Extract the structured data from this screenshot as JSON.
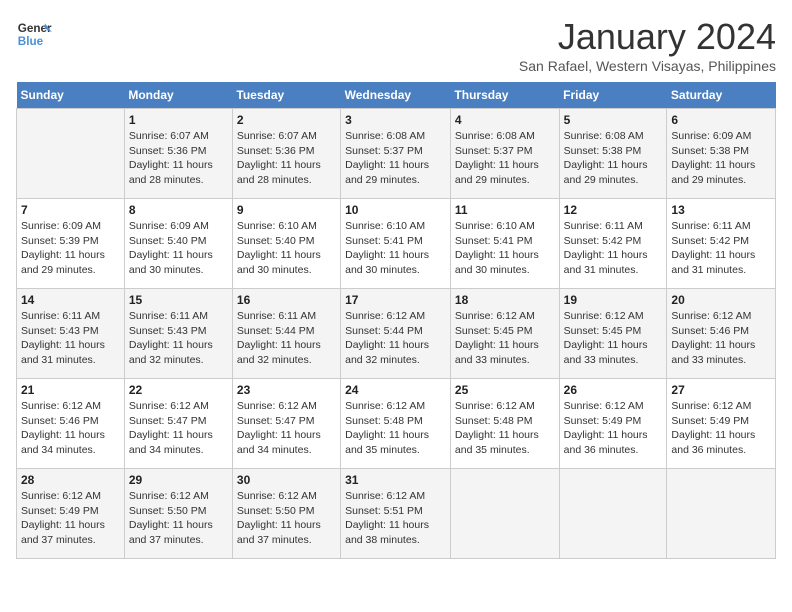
{
  "header": {
    "logo_line1": "General",
    "logo_line2": "Blue",
    "title": "January 2024",
    "subtitle": "San Rafael, Western Visayas, Philippines"
  },
  "columns": [
    "Sunday",
    "Monday",
    "Tuesday",
    "Wednesday",
    "Thursday",
    "Friday",
    "Saturday"
  ],
  "weeks": [
    [
      {
        "day": "",
        "info": ""
      },
      {
        "day": "1",
        "info": "Sunrise: 6:07 AM\nSunset: 5:36 PM\nDaylight: 11 hours\nand 28 minutes."
      },
      {
        "day": "2",
        "info": "Sunrise: 6:07 AM\nSunset: 5:36 PM\nDaylight: 11 hours\nand 28 minutes."
      },
      {
        "day": "3",
        "info": "Sunrise: 6:08 AM\nSunset: 5:37 PM\nDaylight: 11 hours\nand 29 minutes."
      },
      {
        "day": "4",
        "info": "Sunrise: 6:08 AM\nSunset: 5:37 PM\nDaylight: 11 hours\nand 29 minutes."
      },
      {
        "day": "5",
        "info": "Sunrise: 6:08 AM\nSunset: 5:38 PM\nDaylight: 11 hours\nand 29 minutes."
      },
      {
        "day": "6",
        "info": "Sunrise: 6:09 AM\nSunset: 5:38 PM\nDaylight: 11 hours\nand 29 minutes."
      }
    ],
    [
      {
        "day": "7",
        "info": "Sunrise: 6:09 AM\nSunset: 5:39 PM\nDaylight: 11 hours\nand 29 minutes."
      },
      {
        "day": "8",
        "info": "Sunrise: 6:09 AM\nSunset: 5:40 PM\nDaylight: 11 hours\nand 30 minutes."
      },
      {
        "day": "9",
        "info": "Sunrise: 6:10 AM\nSunset: 5:40 PM\nDaylight: 11 hours\nand 30 minutes."
      },
      {
        "day": "10",
        "info": "Sunrise: 6:10 AM\nSunset: 5:41 PM\nDaylight: 11 hours\nand 30 minutes."
      },
      {
        "day": "11",
        "info": "Sunrise: 6:10 AM\nSunset: 5:41 PM\nDaylight: 11 hours\nand 30 minutes."
      },
      {
        "day": "12",
        "info": "Sunrise: 6:11 AM\nSunset: 5:42 PM\nDaylight: 11 hours\nand 31 minutes."
      },
      {
        "day": "13",
        "info": "Sunrise: 6:11 AM\nSunset: 5:42 PM\nDaylight: 11 hours\nand 31 minutes."
      }
    ],
    [
      {
        "day": "14",
        "info": "Sunrise: 6:11 AM\nSunset: 5:43 PM\nDaylight: 11 hours\nand 31 minutes."
      },
      {
        "day": "15",
        "info": "Sunrise: 6:11 AM\nSunset: 5:43 PM\nDaylight: 11 hours\nand 32 minutes."
      },
      {
        "day": "16",
        "info": "Sunrise: 6:11 AM\nSunset: 5:44 PM\nDaylight: 11 hours\nand 32 minutes."
      },
      {
        "day": "17",
        "info": "Sunrise: 6:12 AM\nSunset: 5:44 PM\nDaylight: 11 hours\nand 32 minutes."
      },
      {
        "day": "18",
        "info": "Sunrise: 6:12 AM\nSunset: 5:45 PM\nDaylight: 11 hours\nand 33 minutes."
      },
      {
        "day": "19",
        "info": "Sunrise: 6:12 AM\nSunset: 5:45 PM\nDaylight: 11 hours\nand 33 minutes."
      },
      {
        "day": "20",
        "info": "Sunrise: 6:12 AM\nSunset: 5:46 PM\nDaylight: 11 hours\nand 33 minutes."
      }
    ],
    [
      {
        "day": "21",
        "info": "Sunrise: 6:12 AM\nSunset: 5:46 PM\nDaylight: 11 hours\nand 34 minutes."
      },
      {
        "day": "22",
        "info": "Sunrise: 6:12 AM\nSunset: 5:47 PM\nDaylight: 11 hours\nand 34 minutes."
      },
      {
        "day": "23",
        "info": "Sunrise: 6:12 AM\nSunset: 5:47 PM\nDaylight: 11 hours\nand 34 minutes."
      },
      {
        "day": "24",
        "info": "Sunrise: 6:12 AM\nSunset: 5:48 PM\nDaylight: 11 hours\nand 35 minutes."
      },
      {
        "day": "25",
        "info": "Sunrise: 6:12 AM\nSunset: 5:48 PM\nDaylight: 11 hours\nand 35 minutes."
      },
      {
        "day": "26",
        "info": "Sunrise: 6:12 AM\nSunset: 5:49 PM\nDaylight: 11 hours\nand 36 minutes."
      },
      {
        "day": "27",
        "info": "Sunrise: 6:12 AM\nSunset: 5:49 PM\nDaylight: 11 hours\nand 36 minutes."
      }
    ],
    [
      {
        "day": "28",
        "info": "Sunrise: 6:12 AM\nSunset: 5:49 PM\nDaylight: 11 hours\nand 37 minutes."
      },
      {
        "day": "29",
        "info": "Sunrise: 6:12 AM\nSunset: 5:50 PM\nDaylight: 11 hours\nand 37 minutes."
      },
      {
        "day": "30",
        "info": "Sunrise: 6:12 AM\nSunset: 5:50 PM\nDaylight: 11 hours\nand 37 minutes."
      },
      {
        "day": "31",
        "info": "Sunrise: 6:12 AM\nSunset: 5:51 PM\nDaylight: 11 hours\nand 38 minutes."
      },
      {
        "day": "",
        "info": ""
      },
      {
        "day": "",
        "info": ""
      },
      {
        "day": "",
        "info": ""
      }
    ]
  ]
}
